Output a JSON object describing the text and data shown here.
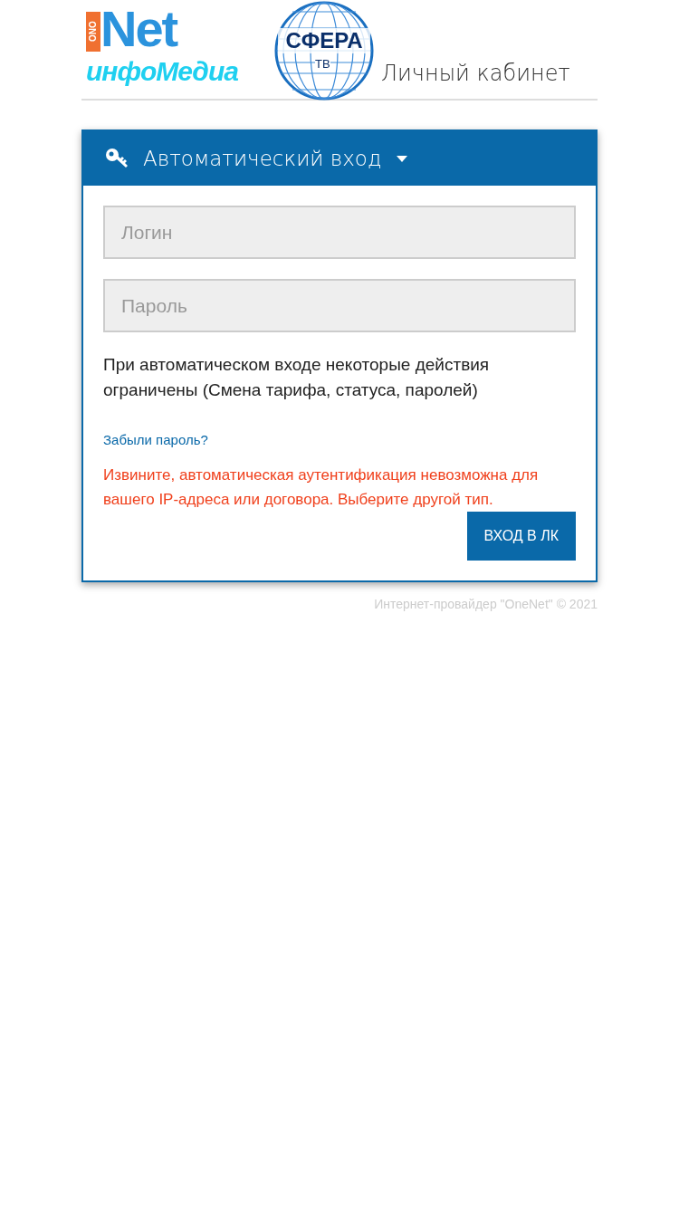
{
  "header": {
    "logos": {
      "onenet_side": "ONO",
      "onenet": "Net",
      "infomedia": "инфоМедиа",
      "sfera": "СФЕРА",
      "sfera_sub": "ТВ"
    },
    "title": "Личный кабинет"
  },
  "login_card": {
    "mode_menu": {
      "label": "Автоматический вход",
      "expanded": false
    },
    "fields": [
      {
        "placeholder": "Логин"
      },
      {
        "placeholder": "Пароль"
      }
    ],
    "notice": "При автоматическом входе некоторые действия ограничены (Смена тарифа, статуса, паролей)",
    "forgot_link": "Забыли пароль?",
    "error": "Извините, автоматическая аутентификация невозможна для вашего IP-адреса или договора. Выберите другой тип.",
    "submit": "ВХОД В ЛК"
  },
  "footer": "Интернет-провайдер \"OneNet\" © 2021"
}
